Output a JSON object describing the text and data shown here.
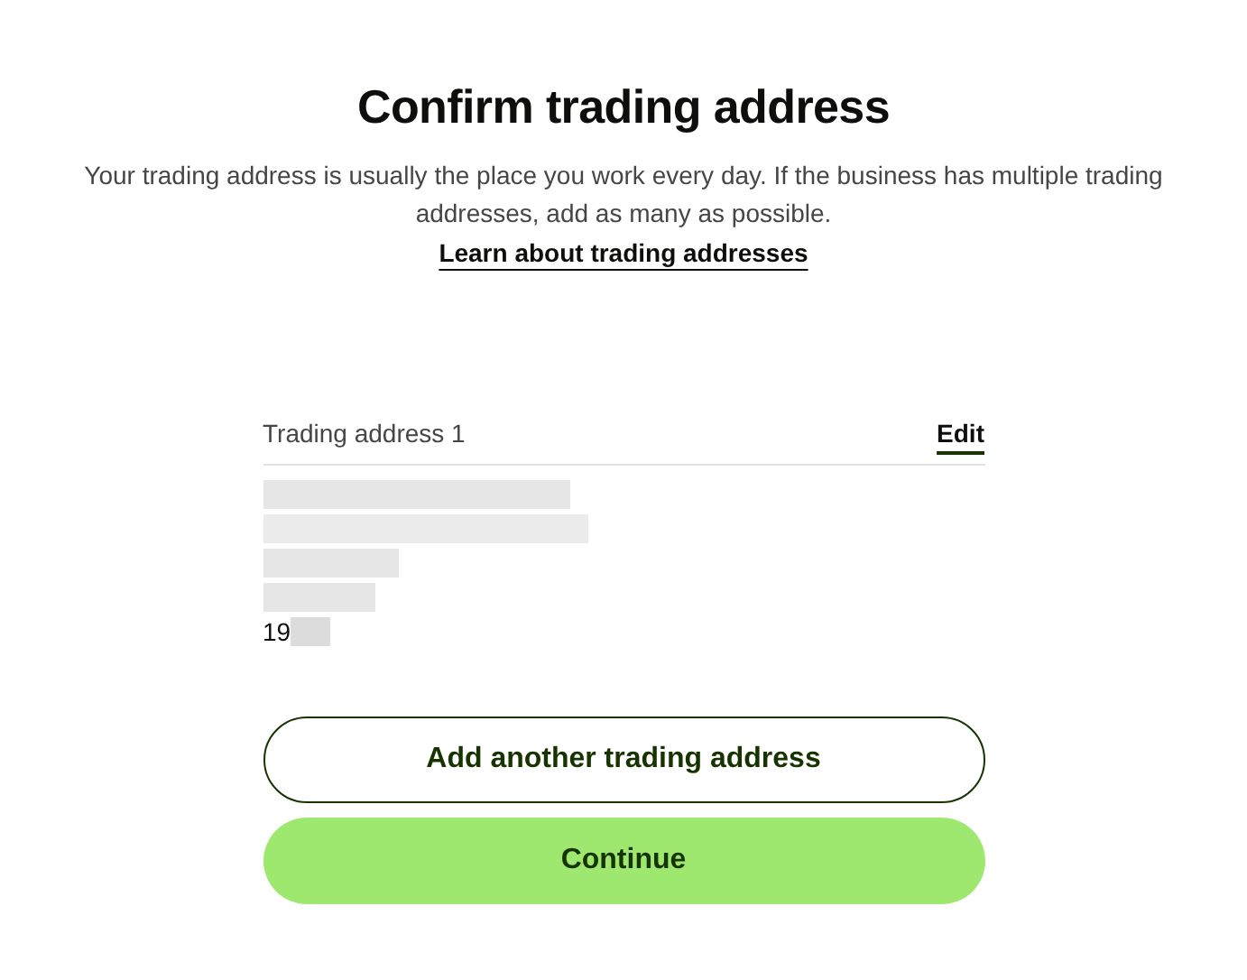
{
  "heading": "Confirm trading address",
  "description": "Your trading address is usually the place you work every day. If the business has multiple trading addresses, add as many as possible.",
  "link": "Learn about trading addresses",
  "addresses": [
    {
      "label": "Trading address 1",
      "action": "Edit",
      "lines": [
        {
          "kind": "redacted"
        },
        {
          "kind": "redacted"
        },
        {
          "kind": "redacted"
        },
        {
          "kind": "redacted"
        },
        {
          "kind": "partial",
          "text": "19"
        }
      ]
    }
  ],
  "buttons": [
    {
      "label": "Add another trading address",
      "kind": "secondary"
    },
    {
      "label": "Continue",
      "kind": "primary"
    }
  ]
}
